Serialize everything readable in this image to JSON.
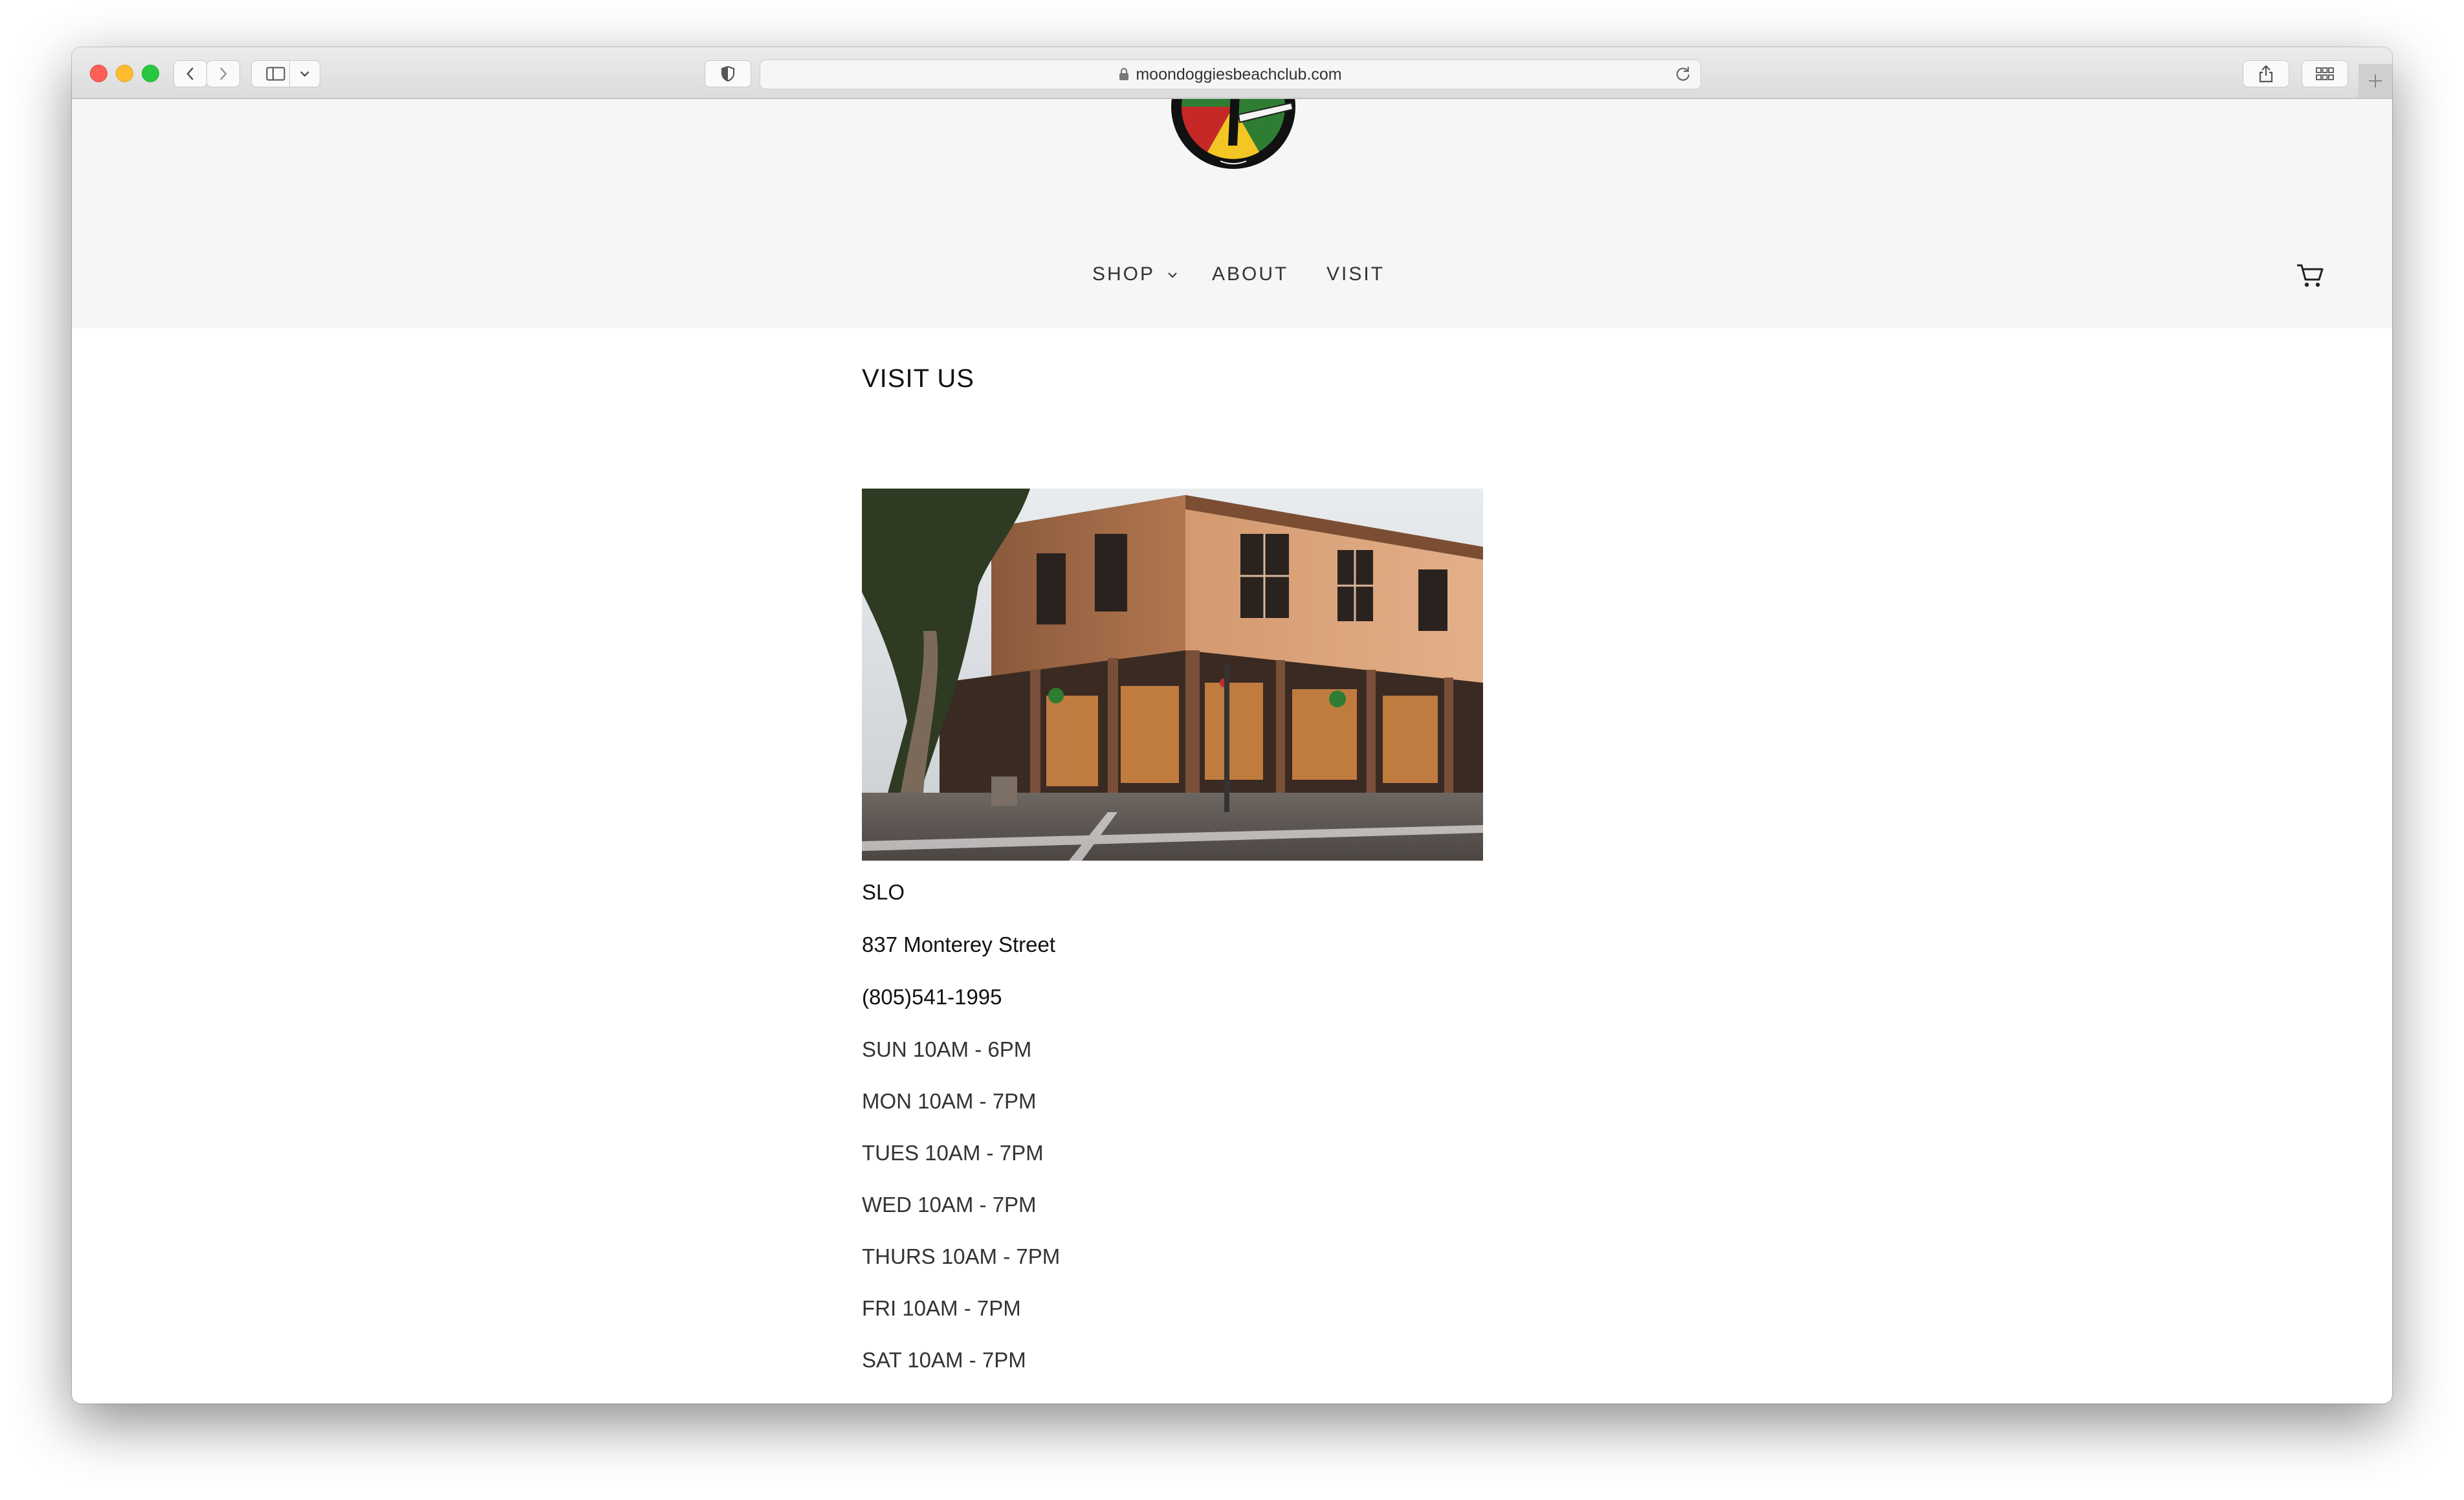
{
  "browser": {
    "url": "moondoggiesbeachclub.com"
  },
  "nav": {
    "shop": "SHOP",
    "about": "ABOUT",
    "visit": "VISIT"
  },
  "page": {
    "title": "VISIT US"
  },
  "location": {
    "name": "SLO",
    "address": "837 Monterey Street",
    "phone": "(805)541-1995",
    "hours": [
      "SUN 10AM - 6PM",
      "MON 10AM - 7PM",
      "TUES 10AM - 7PM",
      "WED 10AM - 7PM",
      "THURS 10AM - 7PM",
      "FRI 10AM - 7PM",
      "SAT 10AM - 7PM"
    ]
  },
  "icons": {
    "back": "chevron-left-icon",
    "forward": "chevron-right-icon",
    "sidebar": "sidebar-icon",
    "privacy": "shield-icon",
    "lock": "lock-icon",
    "reload": "reload-icon",
    "share": "share-icon",
    "tabs": "tab-overview-icon",
    "new_tab": "plus-icon",
    "cart": "cart-icon",
    "dropdown": "chevron-down-icon"
  },
  "colors": {
    "header_bg": "#f6f6f6",
    "text": "#111111"
  }
}
